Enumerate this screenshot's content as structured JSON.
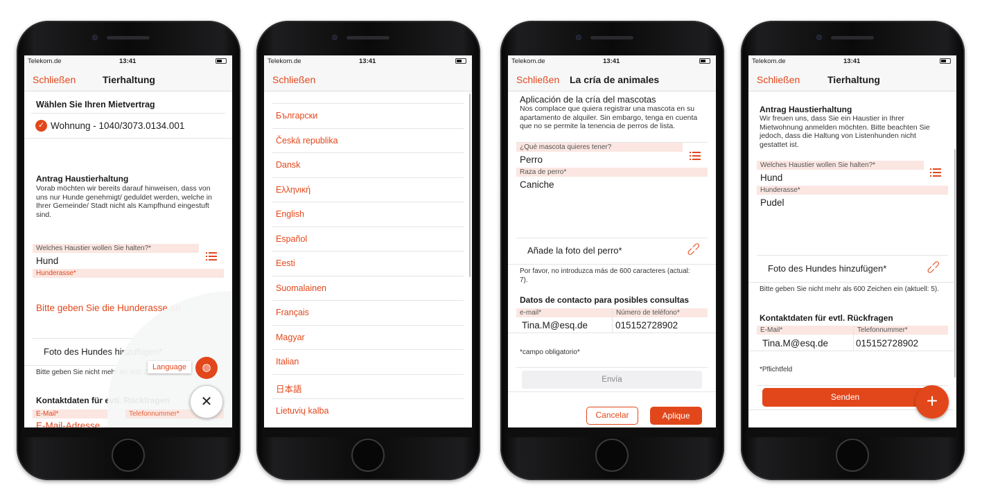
{
  "status_bar": {
    "carrier": "Telekom.de",
    "time": "13:41"
  },
  "colors": {
    "accent": "#e2471b",
    "label_band": "#fbe6e1"
  },
  "phone1": {
    "close": "Schließen",
    "title": "Tierhaltung",
    "contract_heading": "Wählen Sie Ihren Mietvertrag",
    "contract_value": "Wohnung - 1040/3073.0134.001",
    "intro_heading": "Antrag Haustierhaltung",
    "intro_text": "Vorab möchten wir bereits darauf hinweisen, dass von uns nur Hunde genehmigt/  geduldet werden, welche in Ihrer Gemeinde/ Stadt nicht als Kampfhund eingestuft sind.",
    "pet_label": "Welches Haustier wollen Sie halten?*",
    "pet_value": "Hund",
    "breed_label": "Hunderasse*",
    "breed_placeholder": "Bitte geben Sie die Hunderasse an",
    "photo_label": "Foto des Hundes hinzufügen*",
    "char_hint": "Bitte geben Sie nicht mehr als 600 Zeichen ein",
    "contact_heading": "Kontaktdaten für evtl. Rückfragen",
    "email_label": "E-Mail*",
    "email_placeholder": "E-Mail-Adresse",
    "phone_label": "Telefonnummer*",
    "language_tooltip": "Language",
    "icons": {
      "check": "check-circle-icon",
      "list": "list-icon",
      "globe": "globe-icon",
      "close": "close-icon",
      "clip": "paperclip-icon"
    }
  },
  "phone2": {
    "close": "Schließen",
    "languages": [
      "Български",
      "Česká republika",
      "Dansk",
      "Ελληνική",
      "English",
      "Español",
      "Eesti",
      "Suomalainen",
      "Français",
      "Magyar",
      "Italian",
      "日本語",
      "Lietuvių kalba"
    ]
  },
  "phone3": {
    "close": "Schließen",
    "title": "La cría de animales",
    "intro_heading": "Aplicación de la cría del mascotas",
    "intro_text": "Nos complace que quiera registrar una mascota en su apartamento de alquiler. Sin embargo, tenga en cuenta que no se permite la tenencia de perros de lista.",
    "pet_label": "¿Qué mascota quieres tener?",
    "pet_value": "Perro",
    "breed_label": "Raza de perro*",
    "breed_value": "Caniche",
    "photo_label": "Añade la foto del perro*",
    "char_hint": "Por favor, no introduzca más de 600 caracteres (actual: 7).",
    "contact_heading": "Datos de contacto para posibles consultas",
    "email_label": "e-mail*",
    "email_value": "Tina.M@esq.de",
    "phone_label": "Número de teléfono*",
    "phone_value": "015152728902",
    "required_note": "*campo obligatorio*",
    "submit": "Envía",
    "cancel": "Cancelar",
    "apply": "Aplique"
  },
  "phone4": {
    "close": "Schließen",
    "title": "Tierhaltung",
    "intro_heading": "Antrag Haustierhaltung",
    "intro_text": "Wir freuen uns, dass Sie ein Haustier in Ihrer Mietwohnung anmelden möchten. Bitte beachten Sie jedoch, dass die Haltung von Listenhunden nicht gestattet ist.",
    "pet_label": "Welches Haustier wollen Sie halten?*",
    "pet_value": "Hund",
    "breed_label": "Hunderasse*",
    "breed_value": "Pudel",
    "photo_label": "Foto des Hundes hinzufügen*",
    "char_hint": "Bitte geben Sie nicht mehr als 600 Zeichen ein (aktuell: 5).",
    "contact_heading": "Kontaktdaten für evtl. Rückfragen",
    "email_label": "E-Mail*",
    "email_value": "Tina.M@esq.de",
    "phone_label": "Telefonnummer*",
    "phone_value": "015152728902",
    "required_note": "*Pflichtfeld",
    "submit": "Senden"
  }
}
